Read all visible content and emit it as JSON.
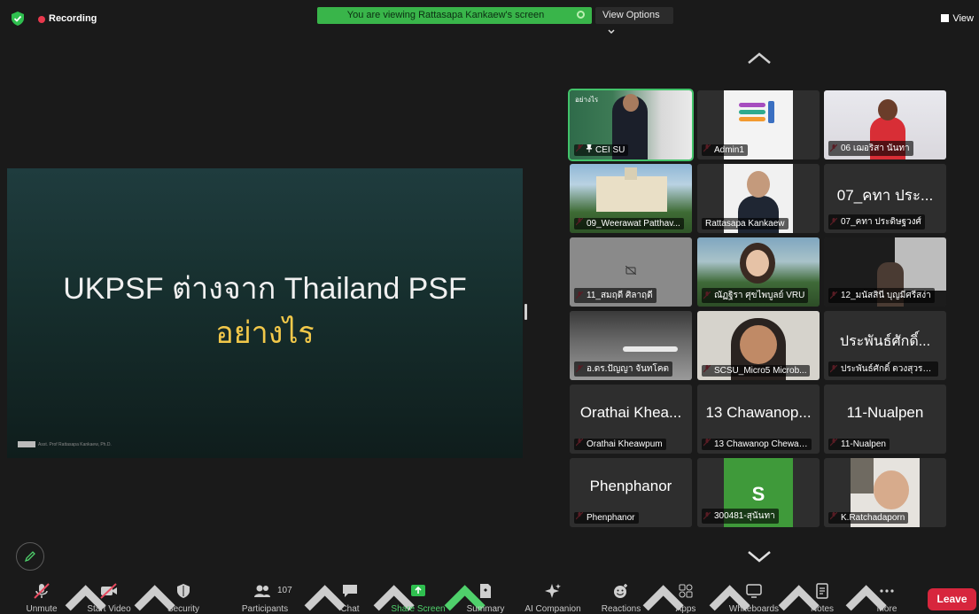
{
  "topbar": {
    "recording_label": "Recording",
    "viewing_banner": "You are viewing Rattasapa Kankaew's screen",
    "view_options_label": "View Options",
    "view_label": "View"
  },
  "slide": {
    "title": "UKPSF ต่างจาก Thailand PSF",
    "subtitle": "อย่างไร",
    "footer": "Asst. Prof Rattasapa Kankaew, Ph.D."
  },
  "participants": [
    {
      "name": "CEI SU",
      "tag": "อย่างไร"
    },
    {
      "name": "Admin1"
    },
    {
      "name": "06 เฌอริสา นันทา"
    },
    {
      "name": "09_Weerawat Patthav..."
    },
    {
      "name": "Rattasapa Kankaew"
    },
    {
      "name": "07_คทา ประดิษฐวงศ์",
      "display": "07_คทา ประ..."
    },
    {
      "name": "11_สมฤดี ศิลาฤดี"
    },
    {
      "name": "ณัฏฐิรา ศุขไพบูลย์ VRU"
    },
    {
      "name": "12_มนัสสินี บุญมีศรีสง่า"
    },
    {
      "name": "อ.ดร.ปัญญา จันทโคต"
    },
    {
      "name": "SCSU_Micro5 Microb..."
    },
    {
      "name": "ประพันธ์ศักดิ์ ดวงสุวรรณ",
      "display": "ประพันธ์ศักดิ์..."
    },
    {
      "name": "Orathai Kheawpum",
      "display": "Orathai Khea..."
    },
    {
      "name": "13 Chawanop Chewar...",
      "display": "13 Chawanop..."
    },
    {
      "name": "11-Nualpen",
      "display": "11-Nualpen"
    },
    {
      "name": "Phenphanor",
      "display": "Phenphanor"
    },
    {
      "name": "300481-สุนันทา",
      "avatar_letter": "S"
    },
    {
      "name": "K.Ratchadaporn"
    }
  ],
  "toolbar": {
    "unmute": "Unmute",
    "start_video": "Start Video",
    "security": "Security",
    "participants": "Participants",
    "participants_count": "107",
    "chat": "Chat",
    "share_screen": "Share Screen",
    "summary": "Summary",
    "ai_companion": "AI Companion",
    "reactions": "Reactions",
    "apps": "Apps",
    "whiteboards": "Whiteboards",
    "notes": "Notes",
    "more": "More",
    "leave": "Leave"
  },
  "colors": {
    "banner_green": "#39b54a",
    "active_tile_border": "#42c36a",
    "leave_red": "#d7263d",
    "slide_subtitle": "#f2c84a"
  }
}
